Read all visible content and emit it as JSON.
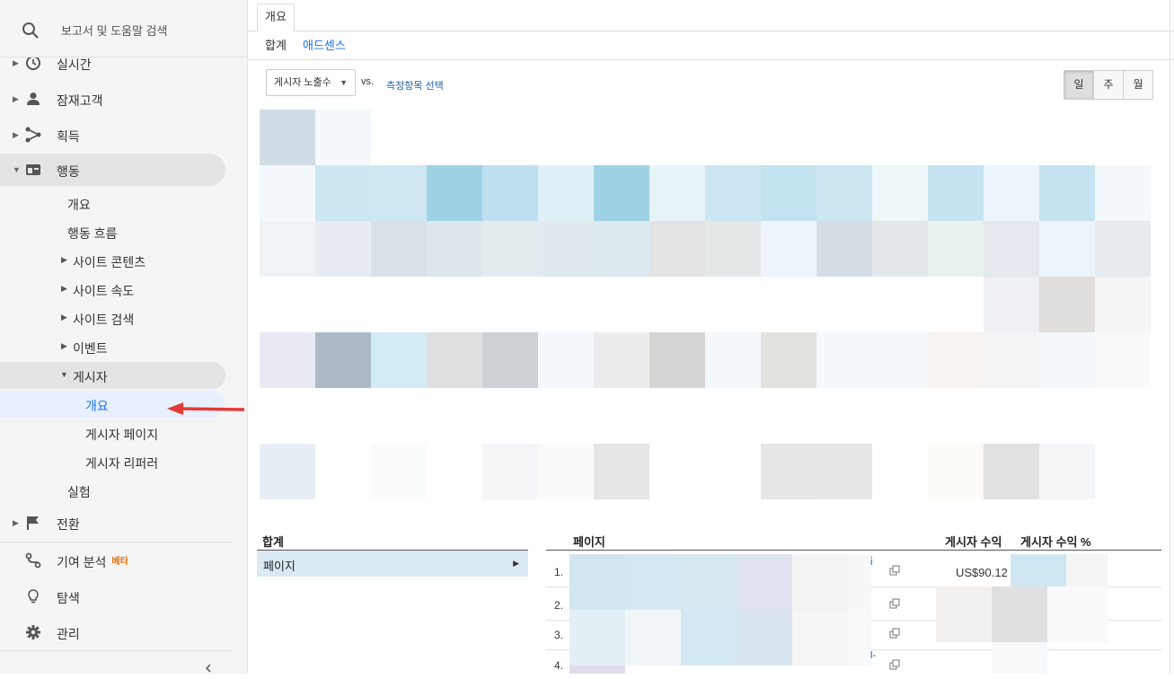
{
  "sidebar": {
    "search_placeholder": "보고서 및 도움말 검색",
    "items": [
      {
        "label": "실시간",
        "icon": "clock-icon"
      },
      {
        "label": "잠재고객",
        "icon": "person-icon"
      },
      {
        "label": "획득",
        "icon": "acquisition-icon"
      },
      {
        "label": "행동",
        "icon": "behavior-icon"
      }
    ],
    "behavior_sub": {
      "overview": "개요",
      "flow": "행동 흐름",
      "site_content": "사이트 콘텐츠",
      "site_speed": "사이트 속도",
      "site_search": "사이트 검색",
      "events": "이벤트",
      "publisher": "게시자",
      "publisher_overview": "개요",
      "publisher_pages": "게시자 페이지",
      "publisher_referrers": "게시자 리퍼러",
      "experiments": "실험"
    },
    "bottom_items": {
      "conversions": "전환",
      "attribution": "기여 분석",
      "attribution_badge": "베타",
      "discover": "탐색",
      "admin": "관리"
    },
    "collapse_icon": "chevron-left-icon"
  },
  "main": {
    "tab": "개요",
    "subtabs": [
      "합계",
      "애드센스"
    ],
    "metric_select": "게시자 노출수",
    "vs": "vs.",
    "compare_link": "측정항목 선택",
    "period_buttons": [
      "일",
      "주",
      "월"
    ],
    "selected_period": "일",
    "summary": {
      "header": "합계",
      "row": "페이지"
    },
    "table": {
      "col_page": "페이지",
      "col_revenue": "게시자 수익",
      "col_revenue_pct": "게시자 수익 %",
      "rows": [
        {
          "num": "1.",
          "revenue": "US$90.12"
        },
        {
          "num": "2.",
          "revenue": ""
        },
        {
          "num": "3.",
          "revenue": ""
        },
        {
          "num": "4.",
          "revenue": ""
        }
      ],
      "link_fragments": [
        "i̇",
        "l-"
      ]
    }
  },
  "colors": {
    "accent": "#1a73e8",
    "annotation_arrow": "#e53935",
    "beta_badge": "#e8710a"
  }
}
